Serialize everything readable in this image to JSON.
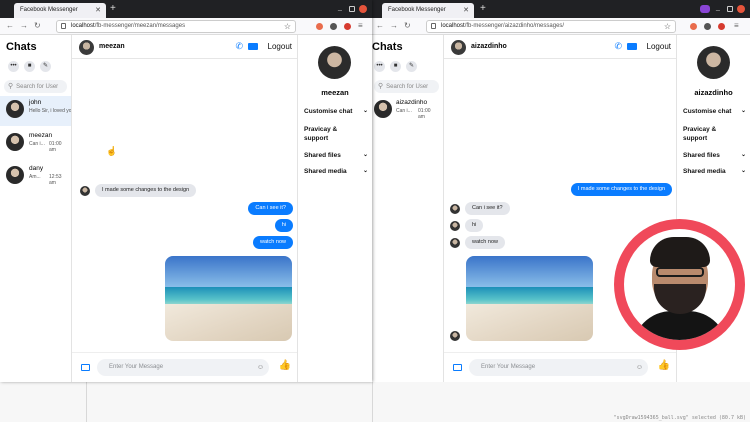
{
  "left": {
    "tab_title": "Facebook Messenger",
    "url_host": "localhost",
    "url_path": "/fb-messenger/meezan/messages",
    "chats_title": "Chats",
    "search_placeholder": "Search for User",
    "chat_list": [
      {
        "name": "john",
        "preview": "Hello Sir, i loved your",
        "time": ""
      },
      {
        "name": "meezan",
        "preview": "Can i...",
        "time": "01:00 am"
      },
      {
        "name": "dany",
        "preview": "Am...",
        "time": "12:53 am"
      }
    ],
    "header_name": "meezan",
    "logout": "Logout",
    "messages": [
      {
        "dir": "in",
        "text": "I made some changes to the design"
      },
      {
        "dir": "out",
        "text": "Can i see it?"
      },
      {
        "dir": "out",
        "text": "hi"
      },
      {
        "dir": "out",
        "text": "watch now"
      }
    ],
    "composer_placeholder": "Enter Your Message",
    "info_name": "meezan",
    "sections": [
      "Customise chat",
      "Pravicay & support",
      "Shared files",
      "Shared media"
    ]
  },
  "right": {
    "tab_title": "Facebook Messenger",
    "url_host": "localhost",
    "url_path": "/fb-messenger/aizazdinho/messages/",
    "chats_title": "Chats",
    "search_placeholder": "Search for User",
    "chat_list": [
      {
        "name": "aizazdinho",
        "preview": "Can i...",
        "time": "01:00 am"
      }
    ],
    "header_name": "aizazdinho",
    "logout": "Logout",
    "messages": [
      {
        "dir": "out",
        "text": "I made some changes to the design"
      },
      {
        "dir": "in",
        "text": "Can i see it?"
      },
      {
        "dir": "in",
        "text": "hi"
      },
      {
        "dir": "in",
        "text": "watch now"
      }
    ],
    "composer_placeholder": "Enter Your Message",
    "info_name": "aizazdinho",
    "sections": [
      "Customise chat",
      "Pravicay & support",
      "Shared files",
      "Shared media"
    ]
  },
  "status_text": "\"svgDraw1594365_ball.svg\" selected (80.7 kB)",
  "colors": {
    "accent": "#0a7cff",
    "ring": "#f0495a",
    "bubble_in": "#e4e6eb"
  }
}
